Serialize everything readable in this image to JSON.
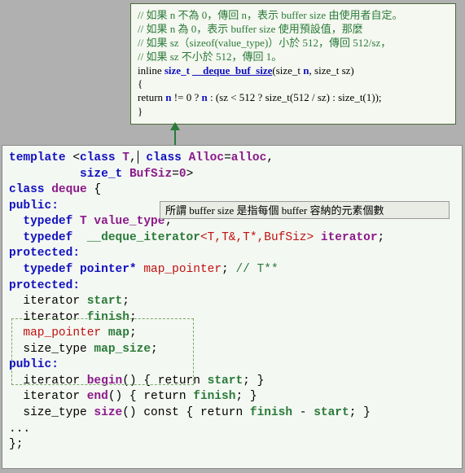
{
  "top": {
    "c1": "// 如果 n 不為 0，傳回 n，表示 buffer size 由使用者自定。",
    "c2": "// 如果 n 為 0，表示 buffer size 使用預設值，那麼",
    "c3": "//   如果 sz（sizeof(value_type)）小於 512，傳回 512/sz，",
    "c4": "//   如果 sz 不小於 512，傳回 1。",
    "inline": "inline",
    "size_t": "size_t",
    "fn": "__deque_buf_size",
    "sig_open": "(size_t ",
    "n": "n",
    "sig_mid": ", size_t sz)",
    "brace_open": "{",
    "ret": " return ",
    "expr1": " != 0 ? ",
    "expr2": " : (sz < 512 ? size_t(512 / sz) : size_t(1));",
    "brace_close": "}"
  },
  "annot": "所謂 buffer size 是指每個 buffer 容納的元素個數",
  "main": {
    "l1a": "template ",
    "l1b": "<",
    "l1c": "class ",
    "l1d": "T",
    "l1e": ",",
    "l1f": " class ",
    "l1g": "Alloc",
    "l1h": "=",
    "l1i": "alloc",
    "l1j": ",",
    "l2a": "          size_t ",
    "l2b": "BufSiz",
    "l2c": "=",
    "l2d": "0",
    "l2e": ">",
    "l3a": "class ",
    "l3b": "deque",
    "l3c": " {",
    "l4": "public:",
    "l5a": "  typedef ",
    "l5b": "T",
    "l5c": " ",
    "l5d": "value_type",
    "l5e": ";",
    "l6a": "  typedef",
    "l6b": "  ",
    "l6c": "__deque_iterator",
    "l6d": "<T,T&,T*,BufSiz>",
    "l6e": " ",
    "l6f": "iterator",
    "l6g": ";",
    "l7": "protected:",
    "l8a": "  typedef pointer* ",
    "l8b": "map_pointer",
    "l8c": "; ",
    "l8d": "// T**",
    "l9": "protected:",
    "l10a": "  iterator ",
    "l10b": "start",
    "l10c": ";",
    "l11a": "  iterator ",
    "l11b": "finish",
    "l11c": ";",
    "l12a": "  ",
    "l12b": "map_pointer",
    "l12c": " ",
    "l12d": "map",
    "l12e": ";",
    "l13a": "  size_type ",
    "l13b": "map_size",
    "l13c": ";",
    "l14": "public:",
    "l15a": "  iterator ",
    "l15b": "begin",
    "l15c": "() { return ",
    "l15d": "start",
    "l15e": "; }",
    "l16a": "  iterator ",
    "l16b": "end",
    "l16c": "() { return ",
    "l16d": "finish",
    "l16e": "; }",
    "l17a": "  size_type ",
    "l17b": "size",
    "l17c": "() const { return ",
    "l17d": "finish",
    "l17e": " - ",
    "l17f": "start",
    "l17g": "; }",
    "l18": "...",
    "l19": "};"
  }
}
